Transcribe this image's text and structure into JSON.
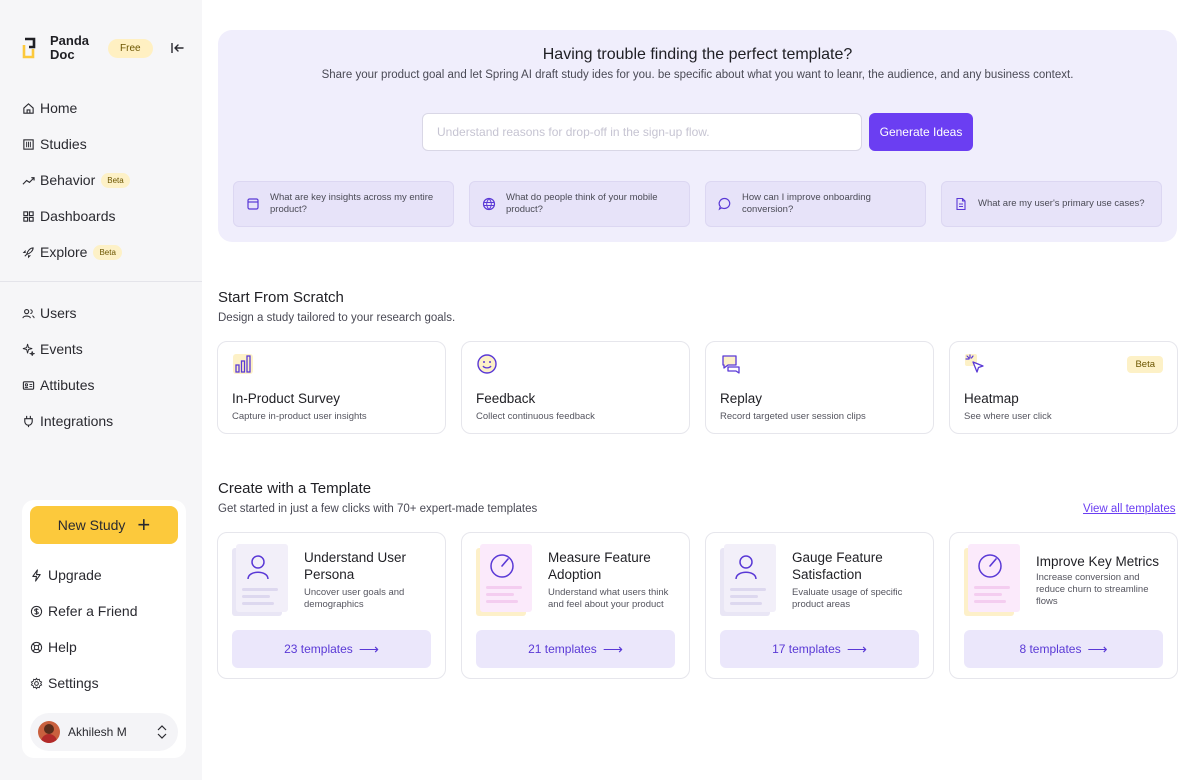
{
  "brand": {
    "name_line1": "Panda",
    "name_line2": "Doc",
    "plan_badge": "Free"
  },
  "nav_primary": [
    {
      "label": "Home",
      "icon": "home-icon",
      "beta": ""
    },
    {
      "label": "Studies",
      "icon": "studies-icon",
      "beta": ""
    },
    {
      "label": "Behavior",
      "icon": "trend-icon",
      "beta": "Beta"
    },
    {
      "label": "Dashboards",
      "icon": "dashboard-icon",
      "beta": ""
    },
    {
      "label": "Explore",
      "icon": "rocket-icon",
      "beta": "Beta"
    }
  ],
  "nav_secondary": [
    {
      "label": "Users",
      "icon": "users-icon"
    },
    {
      "label": "Events",
      "icon": "sparkle-icon"
    },
    {
      "label": "Attibutes",
      "icon": "id-card-icon"
    },
    {
      "label": "Integrations",
      "icon": "plug-icon"
    }
  ],
  "bottom": {
    "new_study_label": "New Study",
    "links": [
      {
        "label": "Upgrade",
        "icon": "bolt-icon"
      },
      {
        "label": "Refer a Friend",
        "icon": "dollar-icon"
      },
      {
        "label": "Help",
        "icon": "lifebuoy-icon"
      },
      {
        "label": "Settings",
        "icon": "gear-icon"
      }
    ],
    "user_name": "Akhilesh M"
  },
  "hero": {
    "title": "Having trouble finding the perfect template?",
    "subtitle": "Share your product goal and let Spring AI draft study ides for you. be specific about what you want to leanr, the audience, and any business context.",
    "input_placeholder": "Understand reasons for drop-off in the sign-up flow.",
    "input_value": "",
    "button_label": "Generate Ideas",
    "suggestions": [
      {
        "text": "What are key insights across my entire product?",
        "icon": "calendar-icon"
      },
      {
        "text": "What do people think of your mobile product?",
        "icon": "globe-icon"
      },
      {
        "text": "How can I improve onboarding conversion?",
        "icon": "chat-icon"
      },
      {
        "text": "What are my user's primary use cases?",
        "icon": "document-icon"
      }
    ]
  },
  "scratch": {
    "title": "Start From Scratch",
    "subtitle": "Design a study tailored to your research goals.",
    "cards": [
      {
        "title": "In-Product Survey",
        "desc": "Capture in-product user insights",
        "icon": "bar-chart-icon",
        "beta": ""
      },
      {
        "title": "Feedback",
        "desc": "Collect continuous feedback",
        "icon": "smiley-icon",
        "beta": ""
      },
      {
        "title": "Replay",
        "desc": "Record targeted user session clips",
        "icon": "replay-chat-icon",
        "beta": ""
      },
      {
        "title": "Heatmap",
        "desc": "See where user click",
        "icon": "cursor-click-icon",
        "beta": "Beta"
      }
    ]
  },
  "templates": {
    "title": "Create with a Template",
    "subtitle": "Get started  in just a few clicks with 70+ expert-made templates",
    "view_all": "View all templates",
    "cards": [
      {
        "title": "Understand User Persona",
        "desc": "Uncover user goals and demographics",
        "count": "23 templates",
        "icon": "person-icon",
        "accent": "#f2eff9"
      },
      {
        "title": "Measure Feature Adoption",
        "desc": "Understand what users think and feel about your product",
        "count": "21 templates",
        "icon": "gauge-icon",
        "accent": "#fbeafb"
      },
      {
        "title": "Gauge Feature Satisfaction",
        "desc": "Evaluate usage of specific product areas",
        "count": "17 templates",
        "icon": "person-icon",
        "accent": "#f2eff9"
      },
      {
        "title": "Improve Key Metrics",
        "desc": "Increase conversion and reduce churn to streamline flows",
        "count": "8 templates",
        "icon": "gauge-icon",
        "accent": "#fbeafb"
      }
    ]
  },
  "colors": {
    "accent": "#6b3ef2",
    "new_study": "#fcc93c",
    "beta_bg": "#fdf1c7",
    "hero_bg": "#f0eefc"
  }
}
